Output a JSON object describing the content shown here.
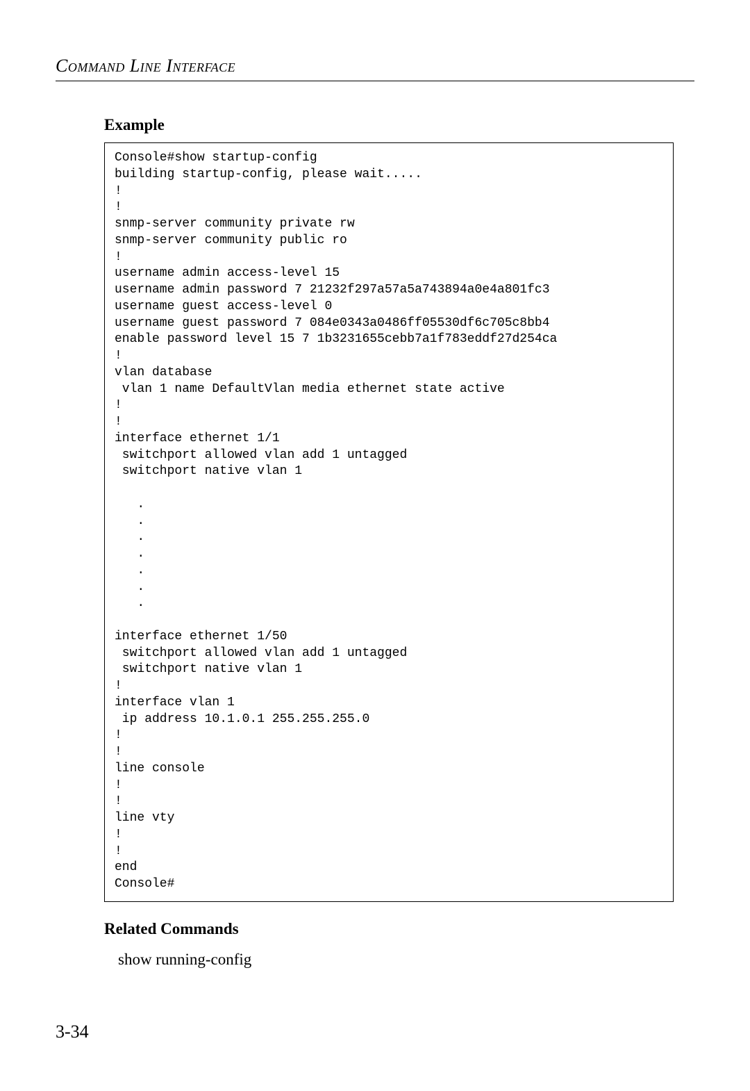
{
  "header": {
    "running_head": "Command Line Interface"
  },
  "sections": {
    "example_heading": "Example",
    "related_heading": "Related Commands",
    "related_body": "show running-config"
  },
  "code_block": "Console#show startup-config\nbuilding startup-config, please wait.....\n!\n!\nsnmp-server community private rw\nsnmp-server community public ro\n!\nusername admin access-level 15\nusername admin password 7 21232f297a57a5a743894a0e4a801fc3\nusername guest access-level 0\nusername guest password 7 084e0343a0486ff05530df6c705c8bb4\nenable password level 15 7 1b3231655cebb7a1f783eddf27d254ca\n!\nvlan database\n vlan 1 name DefaultVlan media ethernet state active\n!\n!\ninterface ethernet 1/1\n switchport allowed vlan add 1 untagged\n switchport native vlan 1\n\n   .\n   .\n   .\n   .\n   .\n   .\n   .\n\ninterface ethernet 1/50\n switchport allowed vlan add 1 untagged\n switchport native vlan 1\n!\ninterface vlan 1\n ip address 10.1.0.1 255.255.255.0\n!\n!\nline console\n!\n!\nline vty\n!\n!\nend\nConsole#",
  "footer": {
    "page_number": "3-34"
  }
}
